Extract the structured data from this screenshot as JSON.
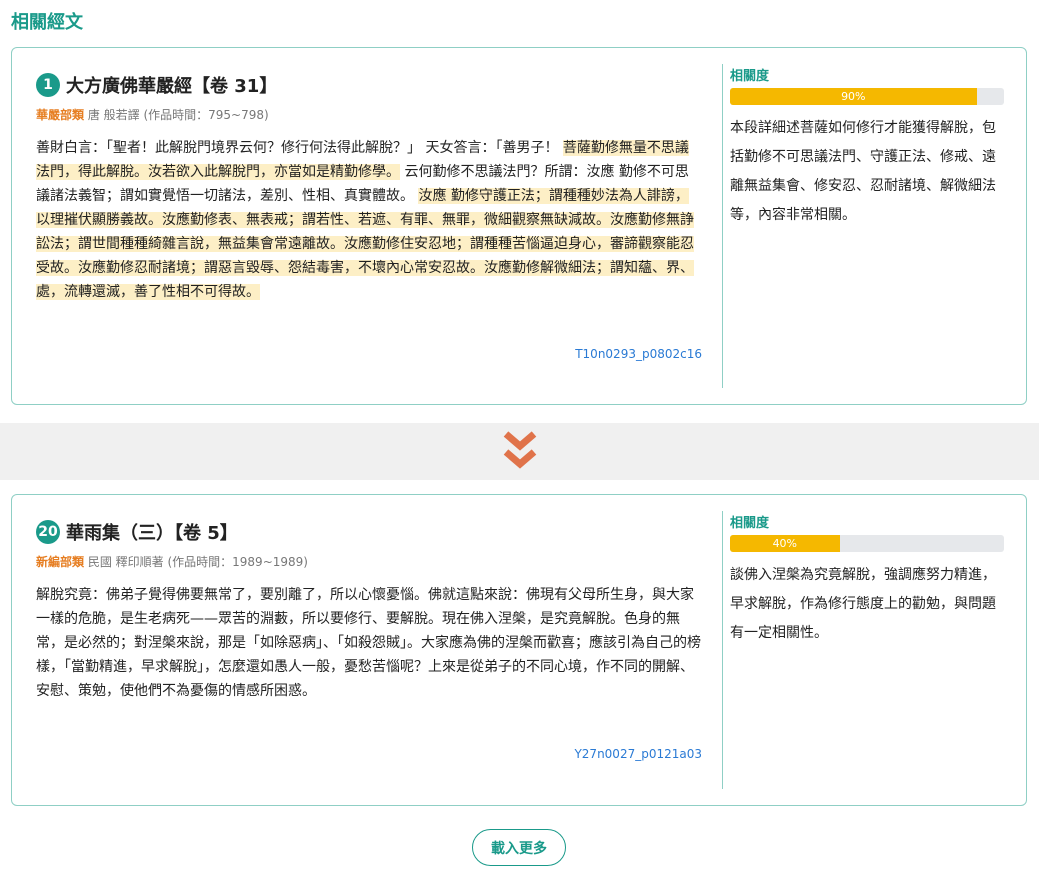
{
  "section_title": "相關經文",
  "relevance_label": "相關度",
  "colors": {
    "accent": "#1a9a8a",
    "bar": "#f5b800",
    "category": "#e67e22",
    "link": "#2a7ad4"
  },
  "results": [
    {
      "number": "1",
      "title": "大方廣佛華嚴經【卷 31】",
      "category": "華嚴部類",
      "author": "唐 般若譯 (作品時間：795~798)",
      "passage_pre": "善財白言：「聖者！此解脫門境界云何？修行何法得此解脫？」 天女答言：「善男子！ ",
      "passage_hl1": "菩薩勤修無量不思議法門，得此解脫。汝若欲入此解脫門，亦當如是精勤修學。",
      "passage_mid": " 云何勤修不思議法門？所謂：汝應 勤修不可思議諸法義智；謂如實覺悟一切諸法，差別、性相、真實體故。 ",
      "passage_hl2": "汝應 勤修守護正法；謂種種妙法為人誹謗，以理摧伏顯勝義故。汝應勤修表、無表戒；謂若性、若遮、有罪、無罪，微細觀察無缺減故。汝應勤修無諍訟法；謂世間種種綺雜言說，無益集會常遠離故。汝應勤修住安忍地；謂種種苦惱逼迫身心，審諦觀察能忍受故。汝應勤修忍耐諸境；謂惡言毀辱、怨結毒害，不壞內心常安忍故。汝應勤修解微細法；謂知蘊、界、處，流轉還滅，善了性相不可得故。",
      "ref": "T10n0293_p0802c16",
      "relevance_percent": 90,
      "relevance_text": "90%",
      "reason": "本段詳細述菩薩如何修行才能獲得解脫，包括勤修不可思議法門、守護正法、修戒、遠離無益集會、修安忍、忍耐諸境、解微細法等，內容非常相關。"
    },
    {
      "number": "20",
      "title": "華雨集（三）【卷 5】",
      "category": "新編部類",
      "author": "民國 釋印順著 (作品時間：1989~1989)",
      "passage": "解脫究竟：佛弟子覺得佛要無常了，要別離了，所以心懷憂惱。佛就這點來說：佛現有父母所生身，與大家一樣的危脆，是生老病死——眾苦的淵藪，所以要修行、要解脫。現在佛入涅槃，是究竟解脫。色身的無常，是必然的；對涅槃來說，那是「如除惡病」、「如殺怨賊」。大家應為佛的涅槃而歡喜；應該引為自己的榜樣，「當勤精進，早求解脫」，怎麼還如愚人一般，憂愁苦惱呢？上來是從弟子的不同心境，作不同的開解、安慰、策勉，使他們不為憂傷的情感所困惑。",
      "ref": "Y27n0027_p0121a03",
      "relevance_percent": 40,
      "relevance_text": "40%",
      "reason": "談佛入涅槃為究竟解脫，強調應努力精進，早求解脫，作為修行態度上的勸勉，與問題有一定相關性。"
    }
  ],
  "load_more_label": "載入更多"
}
